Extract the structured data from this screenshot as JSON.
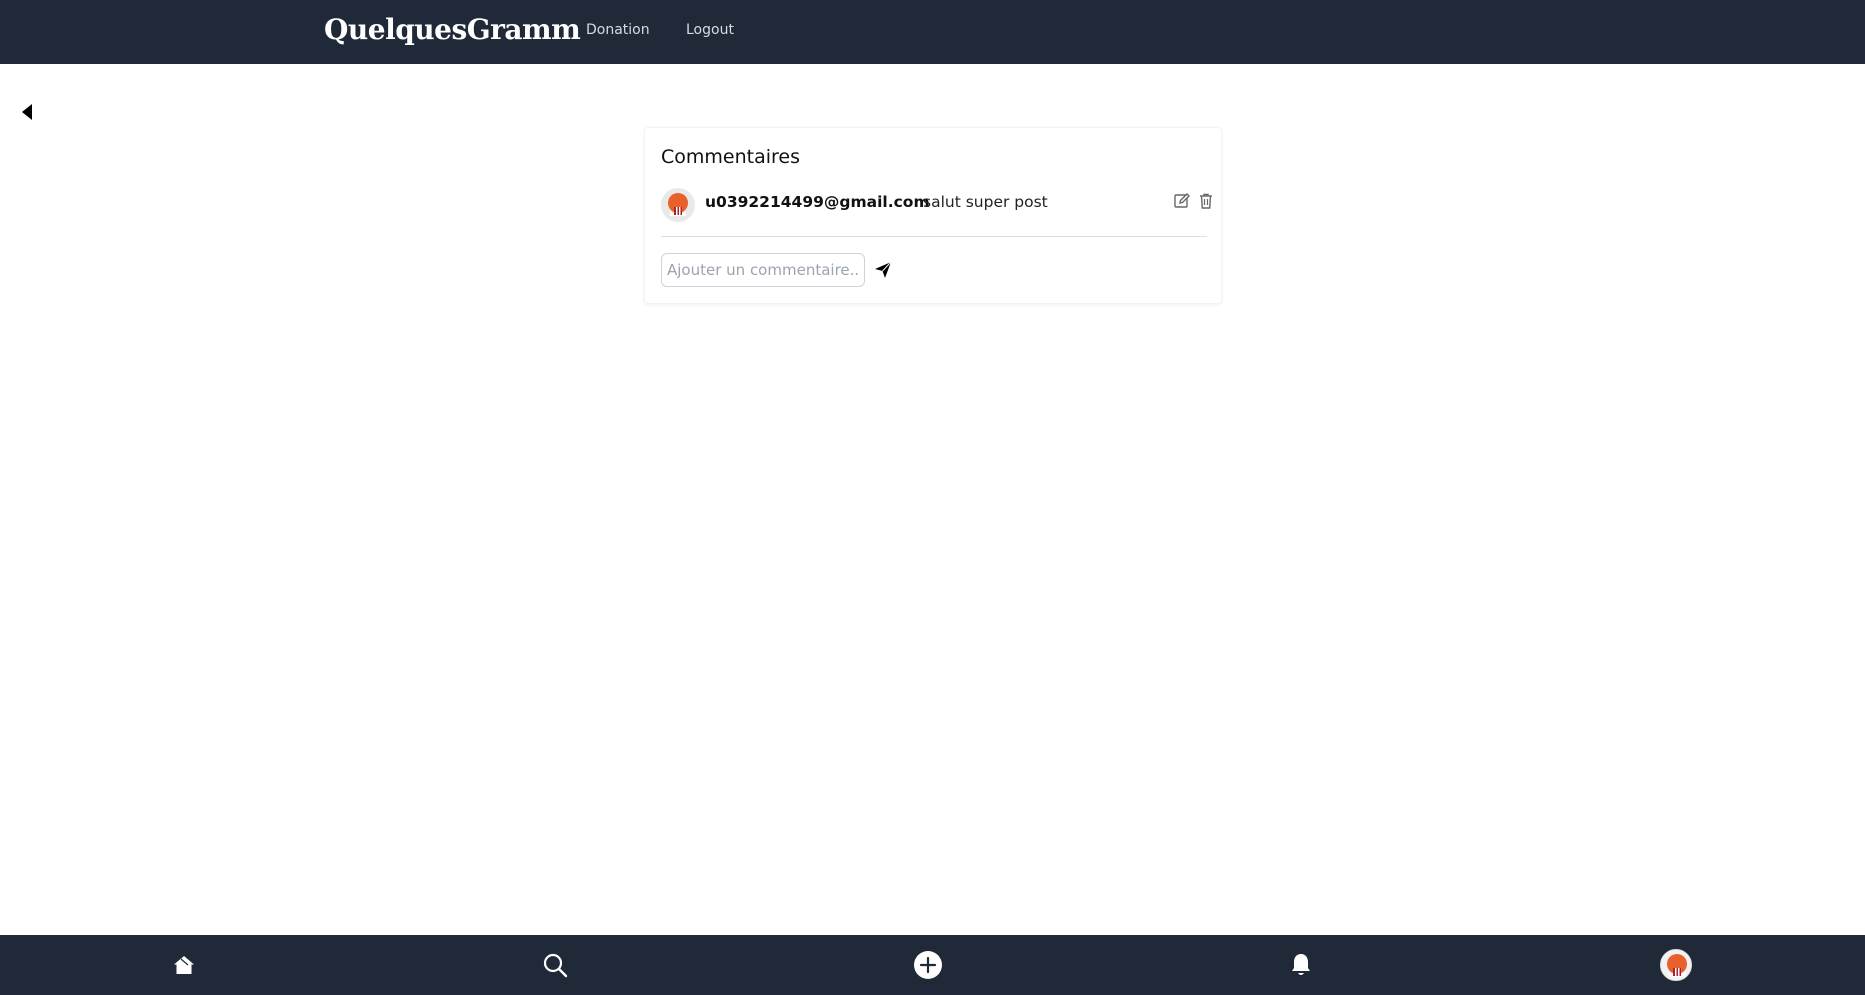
{
  "header": {
    "brand": "QuelquesGramm",
    "nav": [
      {
        "label": "Donation"
      },
      {
        "label": "Logout"
      }
    ]
  },
  "comments_panel": {
    "title": "Commentaires",
    "comments": [
      {
        "author": "u0392214499@gmail.com",
        "text": "salut super post"
      }
    ],
    "input": {
      "placeholder": "Ajouter un commentaire...",
      "value": ""
    }
  },
  "icons": {
    "back": "caret-left-icon",
    "edit": "edit-icon",
    "delete": "trash-icon",
    "send": "send-icon",
    "home": "home-icon",
    "search": "search-icon",
    "add": "plus-circle-icon",
    "notifications": "bell-icon"
  },
  "colors": {
    "nav_bg": "#202938",
    "nav_text": "#d6dae1",
    "accent_avatar": "#e8612c"
  }
}
